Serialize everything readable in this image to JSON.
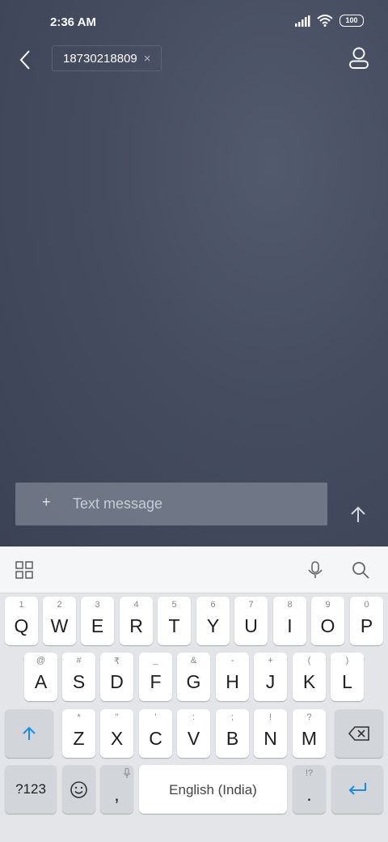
{
  "status_bar": {
    "time": "2:36 AM",
    "battery": "100"
  },
  "header": {
    "recipient": "18730218809",
    "chip_close": "×"
  },
  "compose": {
    "plus": "+",
    "placeholder": "Text message"
  },
  "keyboard": {
    "row1": [
      {
        "hint": "1",
        "key": "Q"
      },
      {
        "hint": "2",
        "key": "W"
      },
      {
        "hint": "3",
        "key": "E"
      },
      {
        "hint": "4",
        "key": "R"
      },
      {
        "hint": "5",
        "key": "T"
      },
      {
        "hint": "6",
        "key": "Y"
      },
      {
        "hint": "7",
        "key": "U"
      },
      {
        "hint": "8",
        "key": "I"
      },
      {
        "hint": "9",
        "key": "O"
      },
      {
        "hint": "0",
        "key": "P"
      }
    ],
    "row2": [
      {
        "hint": "@",
        "key": "A"
      },
      {
        "hint": "#",
        "key": "S"
      },
      {
        "hint": "₹",
        "key": "D"
      },
      {
        "hint": "_",
        "key": "F"
      },
      {
        "hint": "&",
        "key": "G"
      },
      {
        "hint": "-",
        "key": "H"
      },
      {
        "hint": "+",
        "key": "J"
      },
      {
        "hint": "(",
        "key": "K"
      },
      {
        "hint": ")",
        "key": "L"
      }
    ],
    "row3": [
      {
        "hint": "*",
        "key": "Z"
      },
      {
        "hint": "\"",
        "key": "X"
      },
      {
        "hint": "'",
        "key": "C"
      },
      {
        "hint": ":",
        "key": "V"
      },
      {
        "hint": ";",
        "key": "B"
      },
      {
        "hint": "!",
        "key": "N"
      },
      {
        "hint": "?",
        "key": "M"
      }
    ],
    "symbols_key": "?123",
    "comma_key": ",",
    "space_label": "English (India)",
    "period_hint": "!?",
    "period_key": "."
  },
  "colors": {
    "accent": "#1e88e5",
    "background": "#454c60"
  }
}
